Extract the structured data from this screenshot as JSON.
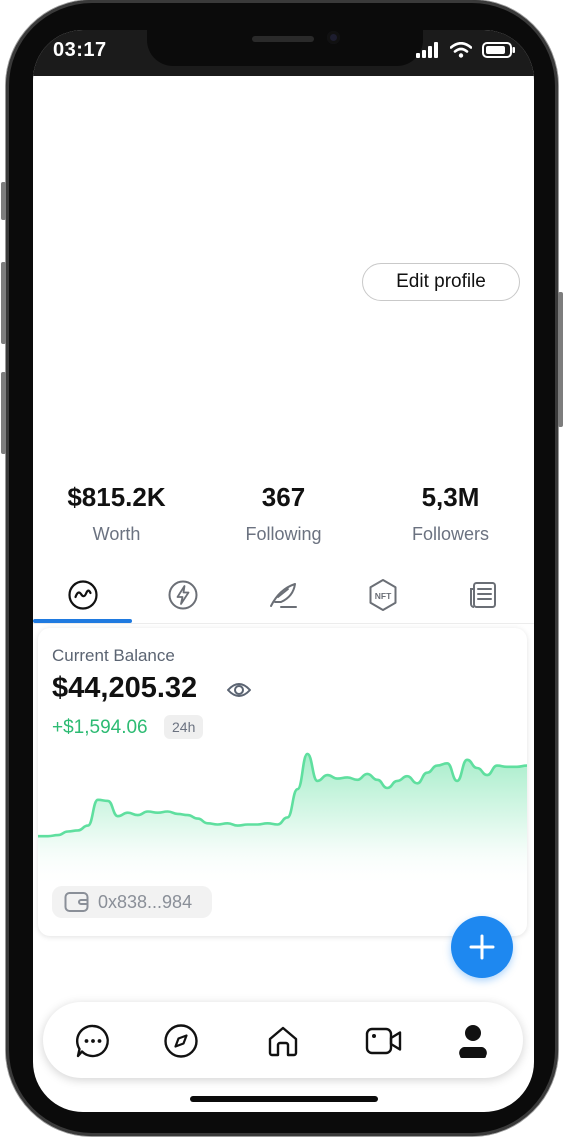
{
  "status_bar": {
    "time": "03:17",
    "icons": [
      "signal-icon",
      "wifi-icon",
      "battery-icon"
    ]
  },
  "profile": {
    "edit_button_label": "Edit profile"
  },
  "stats": [
    {
      "value": "$815.2K",
      "label": "Worth"
    },
    {
      "value": "367",
      "label": "Following"
    },
    {
      "value": "5,3M",
      "label": "Followers"
    }
  ],
  "tabs": [
    {
      "icon": "activity-chart-icon",
      "active": true
    },
    {
      "icon": "lightning-icon",
      "active": false
    },
    {
      "icon": "feather-icon",
      "active": false
    },
    {
      "icon": "nft-badge-icon",
      "text": "NFT",
      "active": false
    },
    {
      "icon": "newspaper-icon",
      "active": false
    }
  ],
  "balance": {
    "title": "Current Balance",
    "value": "$44,205.32",
    "change": "+$1,594.06",
    "period": "24h",
    "wallet_address": "0x838...984",
    "accent_color": "#2dbb73"
  },
  "chart_data": {
    "type": "area",
    "x": [
      0,
      1,
      2,
      3,
      4,
      5,
      6,
      7,
      8,
      9,
      10,
      11,
      12,
      13,
      14,
      15,
      16,
      17,
      18,
      19,
      20,
      21,
      22,
      23,
      24,
      25,
      26,
      27,
      28,
      29,
      30,
      31,
      32,
      33,
      34,
      35,
      36,
      37,
      38,
      39,
      40,
      41,
      42,
      43,
      44,
      45,
      46,
      47,
      48,
      49,
      50,
      51,
      52,
      53,
      54,
      55,
      56,
      57,
      58,
      59
    ],
    "values": [
      10,
      10,
      11,
      14,
      15,
      19,
      41,
      40,
      27,
      30,
      28,
      31,
      30,
      31,
      29,
      28,
      25,
      21,
      20,
      21,
      19,
      20,
      20,
      21,
      20,
      26,
      50,
      80,
      57,
      62,
      59,
      60,
      58,
      63,
      58,
      51,
      57,
      61,
      55,
      64,
      70,
      72,
      57,
      75,
      68,
      62,
      70,
      69,
      69,
      70
    ],
    "title": "",
    "xlabel": "",
    "ylabel": "",
    "grid": false,
    "line_color": "#5fdf9f"
  },
  "bottom_nav": [
    {
      "icon": "chat-bubble-icon",
      "active": false
    },
    {
      "icon": "compass-icon",
      "active": false
    },
    {
      "icon": "home-icon",
      "active": false
    },
    {
      "icon": "video-camera-icon",
      "active": false
    },
    {
      "icon": "profile-icon",
      "active": true
    }
  ]
}
